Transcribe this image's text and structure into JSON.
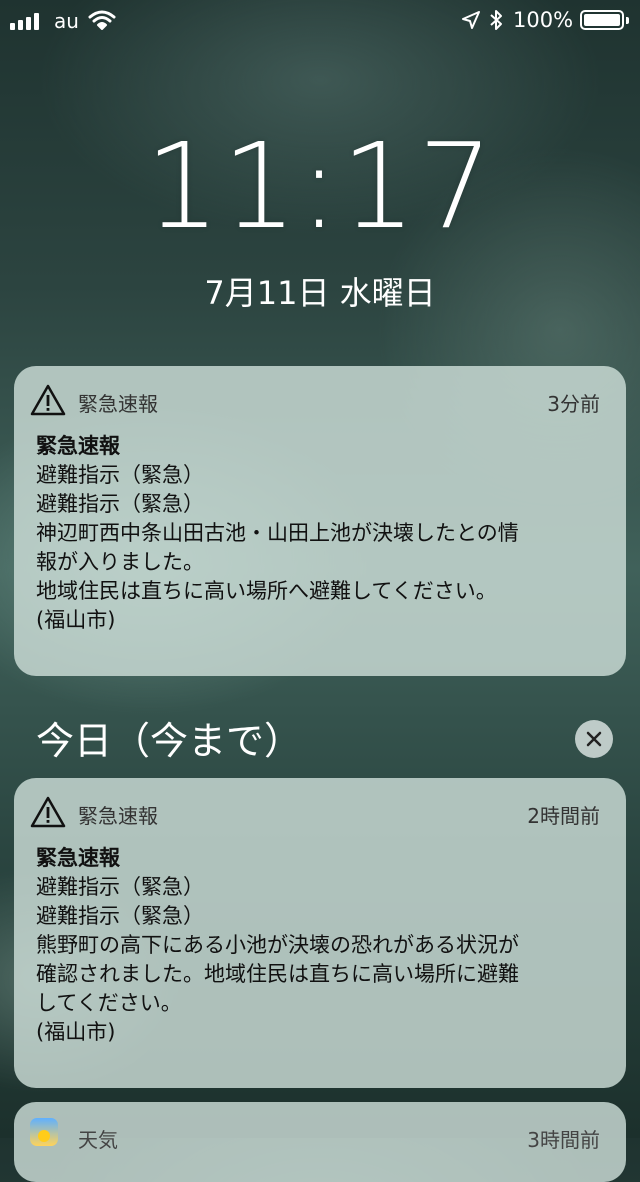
{
  "status": {
    "carrier": "au",
    "battery_percent_label": "100%",
    "battery_level": 1.0
  },
  "lock": {
    "time": "11:17",
    "date": "7月11日 水曜日"
  },
  "notifications": [
    {
      "app": "緊急速報",
      "time": "3分前",
      "title": "緊急速報",
      "lines": [
        "避難指示（緊急）",
        "避難指示（緊急）",
        "神辺町西中条山田古池・山田上池が決壊したとの情",
        "報が入りました。",
        "地域住民は直ちに高い場所へ避難してください。",
        "(福山市)"
      ]
    }
  ],
  "section": {
    "title": "今日（今まで）"
  },
  "today_notifications": [
    {
      "app": "緊急速報",
      "time": "2時間前",
      "title": "緊急速報",
      "lines": [
        "避難指示（緊急）",
        "避難指示（緊急）",
        "熊野町の高下にある小池が決壊の恐れがある状況が",
        "確認されました。地域住民は直ちに高い場所に避難",
        "してください。",
        "(福山市)"
      ]
    },
    {
      "app": "天気",
      "time": "3時間前"
    }
  ],
  "icons": {
    "signal": "signal-bars-icon",
    "wifi": "wifi-icon",
    "location": "location-arrow-icon",
    "bluetooth": "bluetooth-icon",
    "battery": "battery-icon",
    "warning": "warning-triangle-icon",
    "clear": "close-icon",
    "weather": "weather-app-icon"
  }
}
